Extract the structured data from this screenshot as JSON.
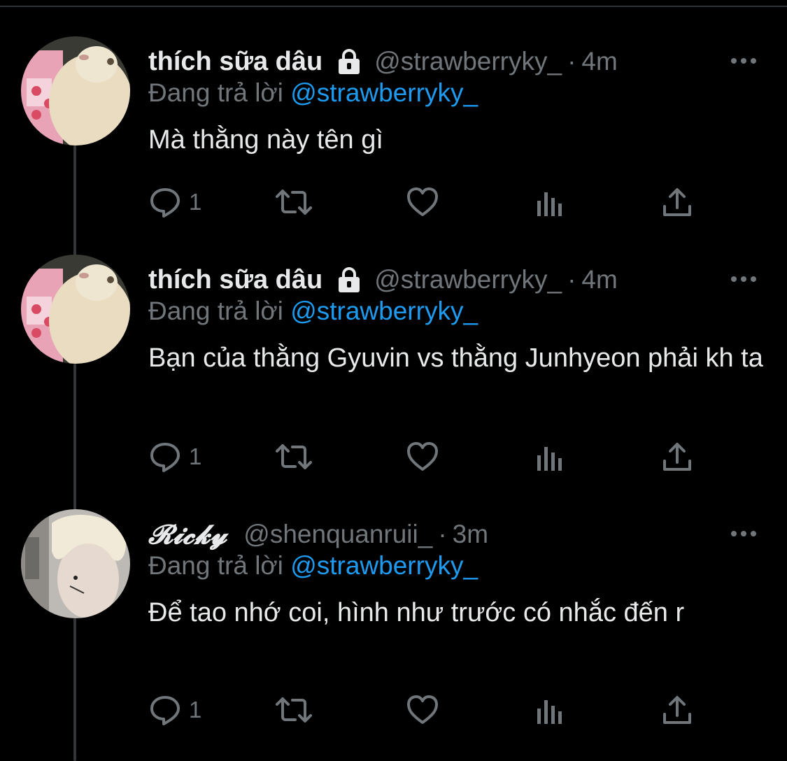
{
  "tweets": [
    {
      "display_name": "thích sữa dâu",
      "handle": "@strawberryky_",
      "separator": "·",
      "time": "4m",
      "replying_prefix": "Đang trả lời",
      "replying_to": "@strawberryky_",
      "text": "Mà thằng này tên gì",
      "reply_count": "1",
      "avatar_icon": "cat-avatar",
      "protected": true
    },
    {
      "display_name": "thích sữa dâu",
      "handle": "@strawberryky_",
      "separator": "·",
      "time": "4m",
      "replying_prefix": "Đang trả lời",
      "replying_to": "@strawberryky_",
      "text": "Bạn của thằng Gyuvin vs thằng Junhyeon phải kh ta",
      "reply_count": "1",
      "avatar_icon": "cat-avatar",
      "protected": true
    },
    {
      "display_name": "𝓡𝓲𝓬𝓴𝔂",
      "handle": "@shenquanruii_",
      "separator": "·",
      "time": "3m",
      "replying_prefix": "Đang trả lời",
      "replying_to": "@strawberryky_",
      "text": "Để tao nhớ coi, hình như trước có nhắc đến r",
      "reply_count": "1",
      "avatar_icon": "person-avatar",
      "protected": false
    }
  ],
  "colors": {
    "background": "#000000",
    "text": "#e7e9ea",
    "muted": "#71767b",
    "link": "#1d9bf0",
    "thread_line": "#333639"
  }
}
